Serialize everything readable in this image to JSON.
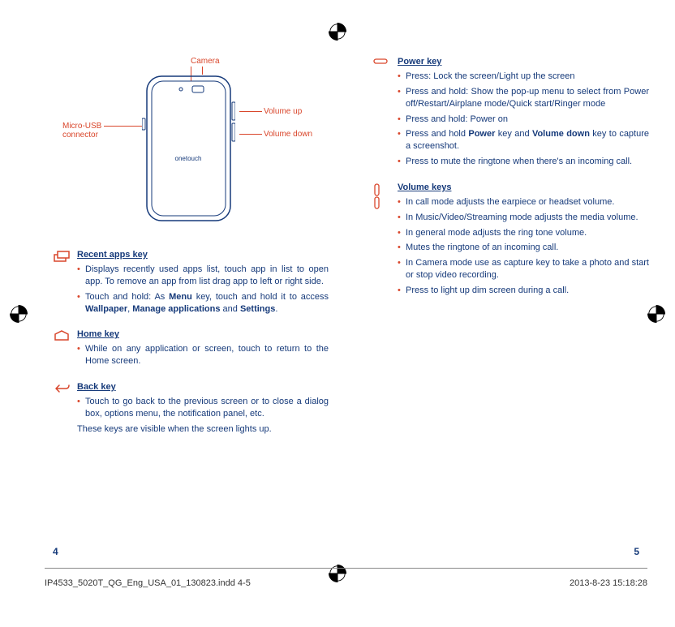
{
  "diagram": {
    "camera": "Camera",
    "micro_usb": "Micro-USB\nconnector",
    "vol_up": "Volume up",
    "vol_down": "Volume down"
  },
  "left": {
    "recent": {
      "title": "Recent apps key",
      "b1": "Displays recently used apps list, touch app in list to open app. To remove an app from list drag app to left or right side.",
      "b2_pre": "Touch and hold: As ",
      "b2_menu": "Menu",
      "b2_mid": " key, touch and hold it to access ",
      "b2_wall": "Wallpaper",
      "b2_comma": ", ",
      "b2_mg": "Manage applications",
      "b2_and": " and ",
      "b2_set": "Settings",
      "b2_end": "."
    },
    "home": {
      "title": "Home key",
      "b1": "While on any application or screen,  touch to return to the Home screen."
    },
    "back": {
      "title": "Back key",
      "b1": "Touch to go back to the previous screen or to close a dialog box, options menu, the notification panel, etc.",
      "note": "These keys are visible when the screen lights up."
    }
  },
  "right": {
    "power": {
      "title": "Power key",
      "b1": "Press: Lock the screen/Light up the screen",
      "b2": "Press and hold: Show the pop-up menu to select from Power off/Restart/Airplane mode/Quick start/Ringer mode",
      "b3": "Press and hold: Power on",
      "b4_pre": "Press and hold ",
      "b4_power": "Power",
      "b4_mid": " key and ",
      "b4_vd": "Volume down",
      "b4_end": " key to capture a screenshot.",
      "b5": "Press to mute the ringtone when there's an incoming call."
    },
    "volume": {
      "title": "Volume keys",
      "b1": "In call mode adjusts the earpiece or headset volume.",
      "b2": "In Music/Video/Streaming mode adjusts the media volume.",
      "b3": "In general mode adjusts the ring tone volume.",
      "b4": "Mutes the ringtone of an incoming call.",
      "b5": "In Camera mode use as capture key to take a photo and start or stop video recording.",
      "b6": "Press to light up dim screen during a call."
    }
  },
  "page_numbers": {
    "left": "4",
    "right": "5"
  },
  "footer": {
    "file": "IP4533_5020T_QG_Eng_USA_01_130823.indd   4-5",
    "timestamp": "2013-8-23   15:18:28"
  }
}
